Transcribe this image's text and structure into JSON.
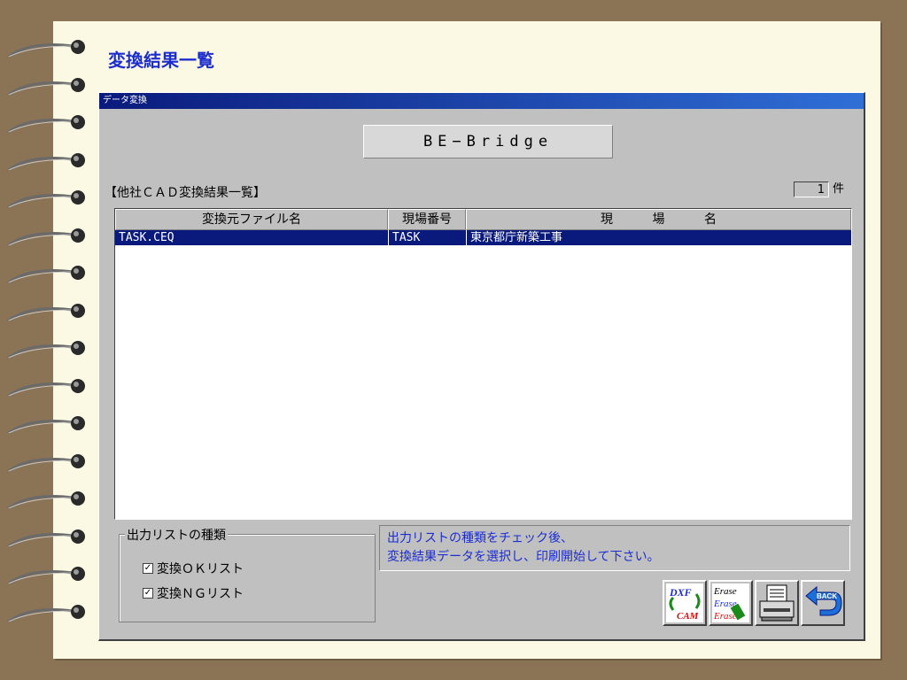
{
  "page": {
    "title": "変換結果一覧"
  },
  "window": {
    "title": "データ変換",
    "product_label": "BE−Bridge",
    "section_title": "【他社ＣＡＤ変換結果一覧】",
    "count": "1",
    "count_unit": "件"
  },
  "table": {
    "columns": [
      "変換元ファイル名",
      "現場番号",
      "現 場 名"
    ],
    "rows": [
      {
        "file": "TASK.CEQ",
        "number": "TASK",
        "name": "東京都庁新築工事",
        "selected": true
      }
    ]
  },
  "output_list": {
    "legend": "出力リストの種類",
    "ok_label": "変換ＯＫリスト",
    "ng_label": "変換ＮＧリスト",
    "ok_checked": true,
    "ng_checked": true
  },
  "message": {
    "line1": "出力リストの種類をチェック後、",
    "line2": "変換結果データを選択し、印刷開始して下さい。"
  },
  "toolbar": {
    "dxf_top": "DXF",
    "dxf_bottom": "CAM",
    "erase_text": "Erase",
    "back_label": "BACK"
  },
  "colors": {
    "accent": "#1c2dd0",
    "selection": "#0a1a7c",
    "window_bg": "#c0c0c0",
    "paper": "#fbf9e4"
  },
  "icons": [
    "dxf-cam-convert-icon",
    "erase-icon",
    "printer-icon",
    "back-arrow-icon",
    "check-icon"
  ]
}
